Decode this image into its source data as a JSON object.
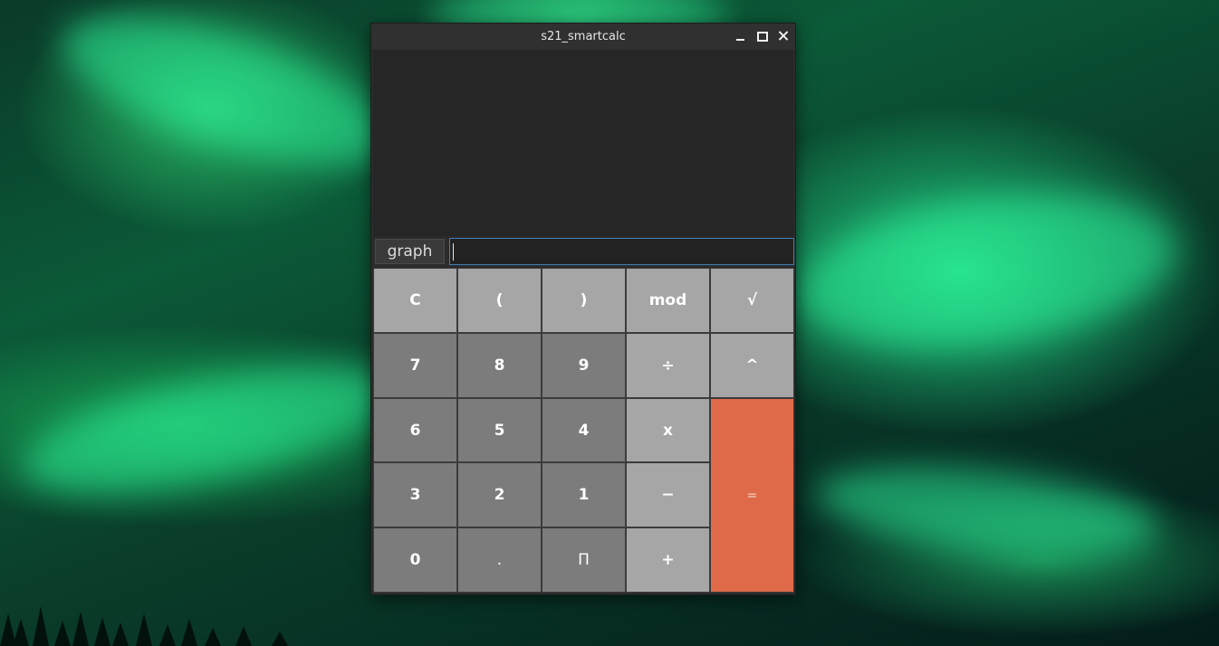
{
  "window": {
    "title": "s21_smartcalc"
  },
  "input_row": {
    "graph_label": "graph",
    "expression_value": "",
    "expression_placeholder": ""
  },
  "keypad": {
    "row1": [
      "C",
      "(",
      ")",
      "mod",
      "√"
    ],
    "row2": [
      "7",
      "8",
      "9",
      "÷",
      "^"
    ],
    "row3": [
      "6",
      "5",
      "4",
      "x"
    ],
    "row4": [
      "3",
      "2",
      "1",
      "−"
    ],
    "row5": [
      "0",
      ".",
      "Π",
      "+"
    ],
    "equals": "="
  },
  "colors": {
    "operator_key": "#a6a6a6",
    "digit_key": "#7c7c7c",
    "equals_key": "#df6a4a",
    "input_focus_border": "#3d7fb8"
  }
}
